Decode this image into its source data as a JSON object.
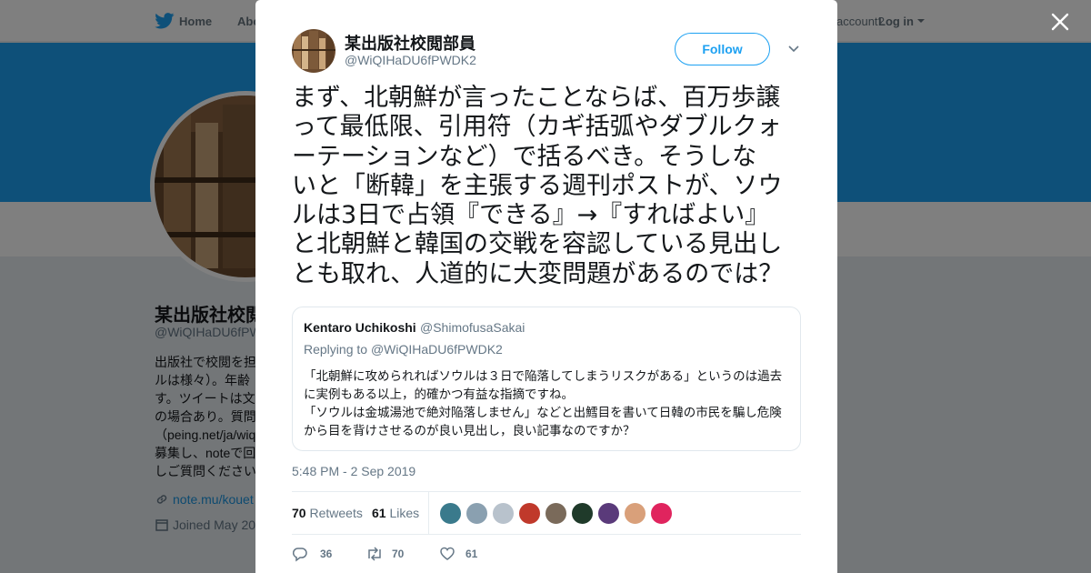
{
  "topnav": {
    "home_label": "Home",
    "about_label": "Abo",
    "account_text": "account?",
    "login_label": "Log in"
  },
  "background_profile": {
    "name": "某出版社校閲",
    "handle": "@WiQIHaDU6fPW",
    "bio_lines": [
      "出版社で校閲を担",
      "ルは様々）。年齢",
      "す。ツイートは文",
      "の場合あり。質問",
      "（peing.net/ja/wiq",
      "募集し、noteで回",
      "しご質問ください"
    ],
    "link_text": "note.mu/kouet",
    "joined_text": "Joined May 20"
  },
  "tweet": {
    "author_name": "某出版社校閲部員",
    "author_handle": "@WiQIHaDU6fPWDK2",
    "follow_label": "Follow",
    "text_lines": [
      "まず、北朝鮮が言ったことならば、百万歩譲",
      "って最低限、引用符（カギ括弧やダブルクォ",
      "ーテーションなど）で括るべき。そうしな",
      "いと「断韓」を主張する週刊ポストが、ソウ",
      "ルは3日で占領『できる』→『すればよい』",
      "と北朝鮮と韓国の交戦を容認している見出し",
      "とも取れ、人道的に大変問題があるのでは？"
    ],
    "timestamp": "5:48 PM - 2 Sep 2019",
    "retweets_count": "70",
    "retweets_label": "Retweets",
    "likes_count": "61",
    "likes_label": "Likes",
    "reply_action_count": "36",
    "retweet_action_count": "70",
    "like_action_count": "61"
  },
  "quoted_tweet": {
    "name": "Kentaro Uchikoshi",
    "handle": "@ShimofusaSakai",
    "replying_prefix": "Replying to",
    "replying_handle": "@WiQIHaDU6fPWDK2",
    "body_lines": [
      "「北朝鮮に攻められればソウルは３日で陥落してしまうリスクがある」というのは過去",
      "に実例もある以上，的確かつ有益な指摘ですね。",
      "「ソウルは金城湯池で絶対陥落しません」などと出鱈目を書いて日韓の市民を騙し危険",
      "から目を背けさせるのが良い見出し，良い記事なのですか？"
    ]
  },
  "colors": {
    "brand": "#1da1f2",
    "text": "#14171a",
    "muted": "#657786",
    "border": "#e1e8ed"
  },
  "likers": [
    {
      "icon": "liker-avatar-1",
      "color": "#3a7a8c"
    },
    {
      "icon": "liker-avatar-2",
      "color": "#8aa0b0"
    },
    {
      "icon": "liker-avatar-3",
      "color": "#b8c2cc"
    },
    {
      "icon": "liker-avatar-4",
      "color": "#c0392b"
    },
    {
      "icon": "liker-avatar-5",
      "color": "#7a6a5a"
    },
    {
      "icon": "liker-avatar-6",
      "color": "#1f3a2a"
    },
    {
      "icon": "liker-avatar-7",
      "color": "#5a3a7a"
    },
    {
      "icon": "liker-avatar-8",
      "color": "#d9a07a"
    },
    {
      "icon": "liker-avatar-9",
      "color": "#e0245e"
    }
  ]
}
